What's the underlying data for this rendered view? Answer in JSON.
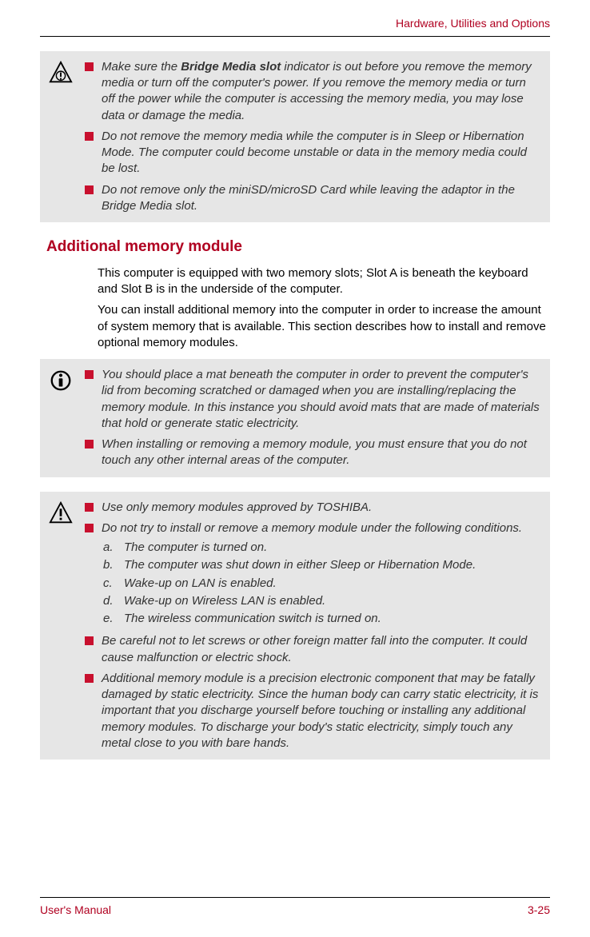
{
  "header": {
    "chapter": "Hardware, Utilities and Options"
  },
  "box1": {
    "items": [
      {
        "html": "Make sure the <b>Bridge Media slot</b> indicator is out before you remove the memory media or turn off the computer's power. If you remove the memory media or turn off the power while the computer is accessing the memory media, you may lose data or damage the media."
      },
      {
        "text": "Do not remove the memory media while the computer is in Sleep or Hibernation Mode. The computer could become unstable or data in the memory media could be lost."
      },
      {
        "text": "Do not remove only the miniSD/microSD Card while leaving the adaptor in the Bridge Media slot."
      }
    ]
  },
  "section": {
    "heading": "Additional memory module",
    "paragraphs": [
      "This computer is equipped with two memory slots; Slot A is beneath the keyboard and Slot B is in the underside of the computer.",
      "You can install additional memory into the computer in order to increase the amount of system memory that is available. This section describes how to install and remove optional memory modules."
    ]
  },
  "box2": {
    "items": [
      {
        "text": "You should place a mat beneath the computer in order to prevent the computer's lid from becoming scratched or damaged when you are installing/replacing the memory module. In this instance you should avoid mats that are made of materials that hold or generate static electricity."
      },
      {
        "text": "When installing or removing a memory module, you must ensure that you do not touch any other internal areas of the computer."
      }
    ]
  },
  "box3": {
    "items": [
      {
        "text": "Use only memory modules approved by TOSHIBA."
      },
      {
        "text": "Do not try to install or remove a memory module under the following conditions.",
        "sub": [
          {
            "letter": "a.",
            "text": "The computer is turned on."
          },
          {
            "letter": "b.",
            "text": "The computer was shut down in either Sleep or Hibernation Mode."
          },
          {
            "letter": "c.",
            "text": "Wake-up on LAN is enabled."
          },
          {
            "letter": "d.",
            "text": "Wake-up on Wireless LAN is enabled."
          },
          {
            "letter": "e.",
            "text": "The wireless communication switch is turned on."
          }
        ]
      },
      {
        "text": "Be careful not to let screws or other foreign matter fall into the computer. It could cause malfunction or electric shock."
      },
      {
        "text": "Additional memory module is a precision electronic component that may be fatally damaged by static electricity. Since the human body can carry static electricity, it is important that you discharge yourself before touching or installing any additional memory modules. To discharge your body's static electricity, simply touch any metal close to you with bare hands."
      }
    ]
  },
  "footer": {
    "left": "User's Manual",
    "right": "3-25"
  }
}
